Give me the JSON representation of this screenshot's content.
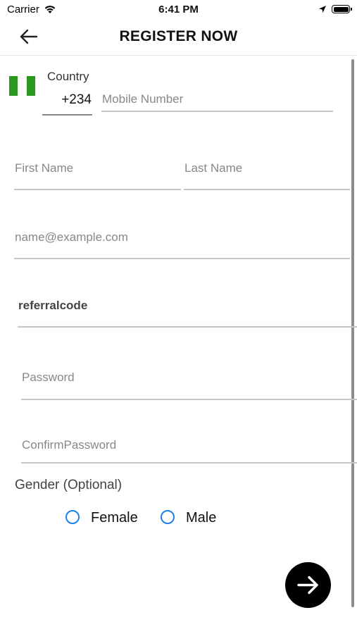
{
  "status_bar": {
    "carrier": "Carrier",
    "time": "6:41 PM"
  },
  "header": {
    "title": "REGISTER NOW"
  },
  "phone": {
    "country_label": "Country",
    "country_code": "+234",
    "mobile_placeholder": "Mobile Number",
    "flag_colors": [
      "#2a9a1f",
      "#ffffff",
      "#2a9a1f"
    ]
  },
  "name": {
    "first_placeholder": "First Name",
    "last_placeholder": "Last Name"
  },
  "email": {
    "placeholder": "name@example.com"
  },
  "referral": {
    "placeholder": "referralcode"
  },
  "password": {
    "placeholder": "Password",
    "confirm_placeholder": "ConfirmPassword"
  },
  "gender": {
    "label": "Gender (Optional)",
    "options": [
      "Female",
      "Male"
    ]
  },
  "colors": {
    "accent": "#1b7ff0",
    "next_button": "#000000"
  }
}
